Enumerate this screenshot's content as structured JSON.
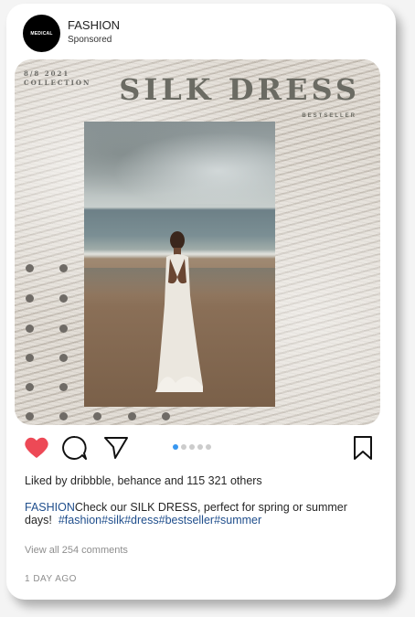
{
  "account": {
    "avatar_text": "MEDICAL",
    "name": "FASHION",
    "subtitle": "Sponsored"
  },
  "media": {
    "date_line1": "8/8 2021",
    "date_line2": "COLLECTION",
    "title": "SILK DRESS",
    "tag": "BESTSELLER"
  },
  "actions": {
    "like_icon": "heart-icon",
    "comment_icon": "comment-icon",
    "share_icon": "send-icon",
    "save_icon": "bookmark-icon",
    "like_color": "#ed4956",
    "carousel_total": 5,
    "carousel_active_index": 0,
    "carousel_active_color": "#3897f0"
  },
  "likes": "Liked by dribbble, behance and 115 321 others",
  "caption": {
    "user": "FASHION",
    "text": "Check our SILK DRESS, perfect for spring or summer days!",
    "hashtags": "#fashion#silk#dress#bestseller#summer"
  },
  "comments_link": "View all 254 comments",
  "timestamp": "1 DAY AGO"
}
